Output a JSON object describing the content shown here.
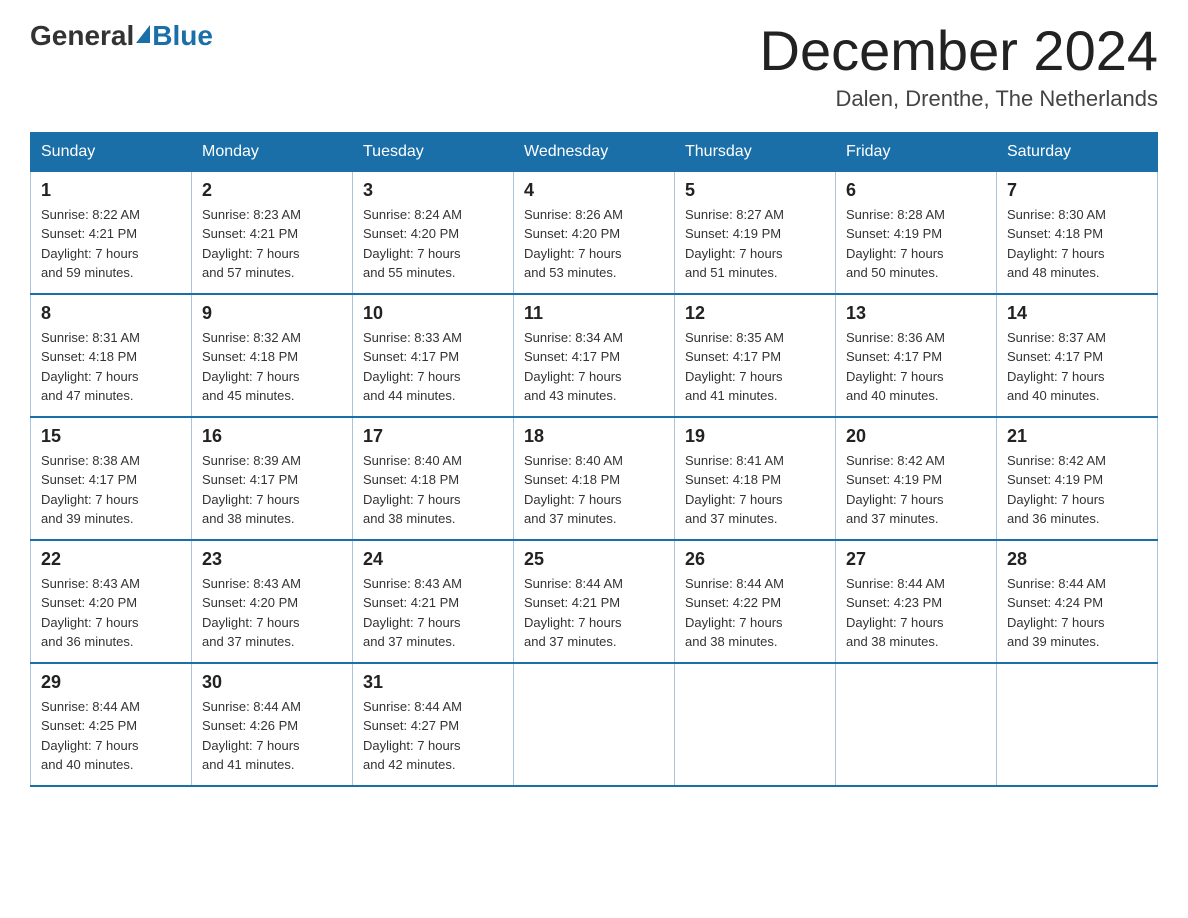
{
  "logo": {
    "general": "General",
    "blue": "Blue",
    "subtitle": ""
  },
  "header": {
    "month_year": "December 2024",
    "location": "Dalen, Drenthe, The Netherlands"
  },
  "days_of_week": [
    "Sunday",
    "Monday",
    "Tuesday",
    "Wednesday",
    "Thursday",
    "Friday",
    "Saturday"
  ],
  "weeks": [
    [
      {
        "day": "1",
        "sunrise": "8:22 AM",
        "sunset": "4:21 PM",
        "daylight": "7 hours and 59 minutes."
      },
      {
        "day": "2",
        "sunrise": "8:23 AM",
        "sunset": "4:21 PM",
        "daylight": "7 hours and 57 minutes."
      },
      {
        "day": "3",
        "sunrise": "8:24 AM",
        "sunset": "4:20 PM",
        "daylight": "7 hours and 55 minutes."
      },
      {
        "day": "4",
        "sunrise": "8:26 AM",
        "sunset": "4:20 PM",
        "daylight": "7 hours and 53 minutes."
      },
      {
        "day": "5",
        "sunrise": "8:27 AM",
        "sunset": "4:19 PM",
        "daylight": "7 hours and 51 minutes."
      },
      {
        "day": "6",
        "sunrise": "8:28 AM",
        "sunset": "4:19 PM",
        "daylight": "7 hours and 50 minutes."
      },
      {
        "day": "7",
        "sunrise": "8:30 AM",
        "sunset": "4:18 PM",
        "daylight": "7 hours and 48 minutes."
      }
    ],
    [
      {
        "day": "8",
        "sunrise": "8:31 AM",
        "sunset": "4:18 PM",
        "daylight": "7 hours and 47 minutes."
      },
      {
        "day": "9",
        "sunrise": "8:32 AM",
        "sunset": "4:18 PM",
        "daylight": "7 hours and 45 minutes."
      },
      {
        "day": "10",
        "sunrise": "8:33 AM",
        "sunset": "4:17 PM",
        "daylight": "7 hours and 44 minutes."
      },
      {
        "day": "11",
        "sunrise": "8:34 AM",
        "sunset": "4:17 PM",
        "daylight": "7 hours and 43 minutes."
      },
      {
        "day": "12",
        "sunrise": "8:35 AM",
        "sunset": "4:17 PM",
        "daylight": "7 hours and 41 minutes."
      },
      {
        "day": "13",
        "sunrise": "8:36 AM",
        "sunset": "4:17 PM",
        "daylight": "7 hours and 40 minutes."
      },
      {
        "day": "14",
        "sunrise": "8:37 AM",
        "sunset": "4:17 PM",
        "daylight": "7 hours and 40 minutes."
      }
    ],
    [
      {
        "day": "15",
        "sunrise": "8:38 AM",
        "sunset": "4:17 PM",
        "daylight": "7 hours and 39 minutes."
      },
      {
        "day": "16",
        "sunrise": "8:39 AM",
        "sunset": "4:17 PM",
        "daylight": "7 hours and 38 minutes."
      },
      {
        "day": "17",
        "sunrise": "8:40 AM",
        "sunset": "4:18 PM",
        "daylight": "7 hours and 38 minutes."
      },
      {
        "day": "18",
        "sunrise": "8:40 AM",
        "sunset": "4:18 PM",
        "daylight": "7 hours and 37 minutes."
      },
      {
        "day": "19",
        "sunrise": "8:41 AM",
        "sunset": "4:18 PM",
        "daylight": "7 hours and 37 minutes."
      },
      {
        "day": "20",
        "sunrise": "8:42 AM",
        "sunset": "4:19 PM",
        "daylight": "7 hours and 37 minutes."
      },
      {
        "day": "21",
        "sunrise": "8:42 AM",
        "sunset": "4:19 PM",
        "daylight": "7 hours and 36 minutes."
      }
    ],
    [
      {
        "day": "22",
        "sunrise": "8:43 AM",
        "sunset": "4:20 PM",
        "daylight": "7 hours and 36 minutes."
      },
      {
        "day": "23",
        "sunrise": "8:43 AM",
        "sunset": "4:20 PM",
        "daylight": "7 hours and 37 minutes."
      },
      {
        "day": "24",
        "sunrise": "8:43 AM",
        "sunset": "4:21 PM",
        "daylight": "7 hours and 37 minutes."
      },
      {
        "day": "25",
        "sunrise": "8:44 AM",
        "sunset": "4:21 PM",
        "daylight": "7 hours and 37 minutes."
      },
      {
        "day": "26",
        "sunrise": "8:44 AM",
        "sunset": "4:22 PM",
        "daylight": "7 hours and 38 minutes."
      },
      {
        "day": "27",
        "sunrise": "8:44 AM",
        "sunset": "4:23 PM",
        "daylight": "7 hours and 38 minutes."
      },
      {
        "day": "28",
        "sunrise": "8:44 AM",
        "sunset": "4:24 PM",
        "daylight": "7 hours and 39 minutes."
      }
    ],
    [
      {
        "day": "29",
        "sunrise": "8:44 AM",
        "sunset": "4:25 PM",
        "daylight": "7 hours and 40 minutes."
      },
      {
        "day": "30",
        "sunrise": "8:44 AM",
        "sunset": "4:26 PM",
        "daylight": "7 hours and 41 minutes."
      },
      {
        "day": "31",
        "sunrise": "8:44 AM",
        "sunset": "4:27 PM",
        "daylight": "7 hours and 42 minutes."
      },
      null,
      null,
      null,
      null
    ]
  ],
  "labels": {
    "sunrise": "Sunrise:",
    "sunset": "Sunset:",
    "daylight": "Daylight:"
  }
}
